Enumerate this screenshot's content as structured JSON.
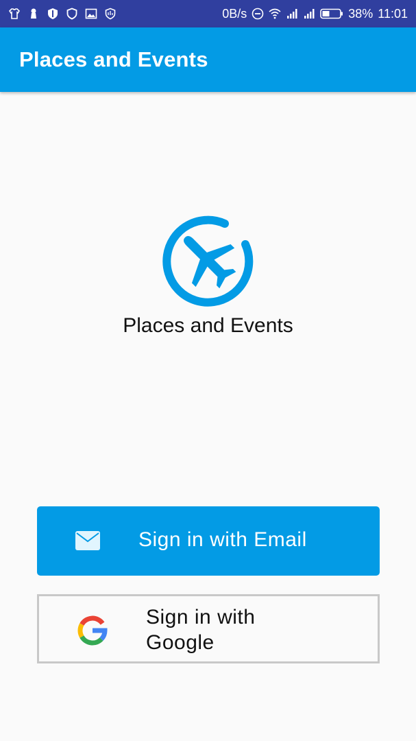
{
  "status_bar": {
    "net_speed": "0B/s",
    "battery": "38%",
    "time": "11:01",
    "icons": [
      "shirt-icon",
      "keyhole-icon",
      "shield-check-icon",
      "shield-icon",
      "image-icon",
      "shield-app-icon",
      "dnd-icon",
      "wifi-icon",
      "signal-icon",
      "signal-icon-2",
      "battery-icon"
    ]
  },
  "app_bar": {
    "title": "Places and Events"
  },
  "logo": {
    "caption": "Places and Events",
    "icon": "airplane-circle-icon"
  },
  "buttons": {
    "email": {
      "label": "Sign in with Email",
      "icon": "mail-icon"
    },
    "google": {
      "label": "Sign in with Google",
      "icon": "google-g-icon"
    }
  },
  "colors": {
    "status_bar": "#303f9f",
    "primary": "#039be5",
    "background": "#fafafa",
    "button_border": "#c8c8c8"
  }
}
